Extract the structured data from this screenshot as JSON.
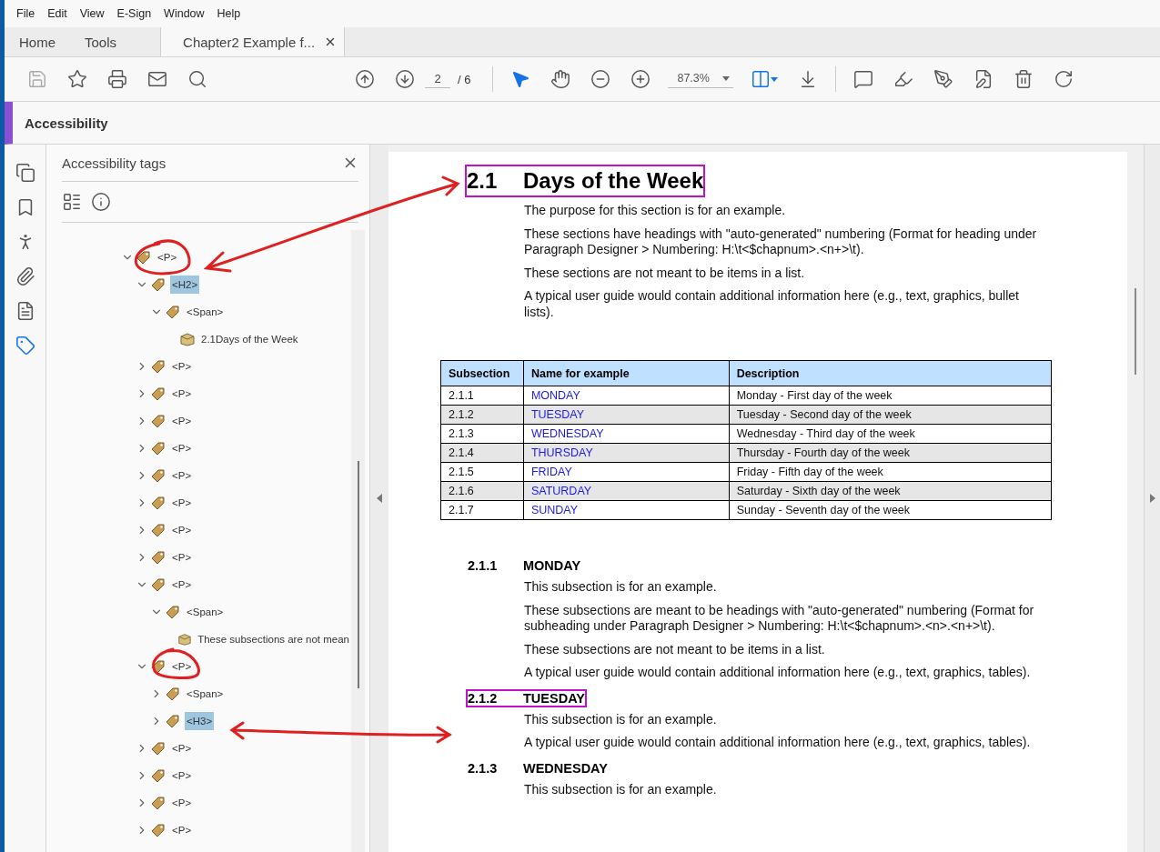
{
  "menu": [
    "File",
    "Edit",
    "View",
    "E-Sign",
    "Window",
    "Help"
  ],
  "tabs": [
    {
      "label": "Home",
      "kind": "nav",
      "selected": false
    },
    {
      "label": "Tools",
      "kind": "nav",
      "selected": false
    },
    {
      "label": "Chapter2 Example f...",
      "kind": "document",
      "selected": true
    }
  ],
  "toolbar": {
    "page": "2",
    "page_count": "/ 6",
    "zoom": "87.3%"
  },
  "tool_panel": {
    "title": "Accessibility"
  },
  "side_rail": [
    {
      "kind": "pages",
      "selected": false
    },
    {
      "kind": "bookmarks",
      "selected": false
    },
    {
      "kind": "accessibility",
      "selected": false
    },
    {
      "kind": "attachments",
      "selected": false
    },
    {
      "kind": "content",
      "selected": false
    },
    {
      "kind": "tags",
      "selected": true
    }
  ],
  "tags_panel": {
    "title": "Accessibility tags",
    "tree": [
      {
        "label": "<P>",
        "kind": "tag",
        "expanded": true,
        "selected": false,
        "children": [
          {
            "label": "<H2>",
            "kind": "tag",
            "expanded": true,
            "selected": true,
            "children": [
              {
                "label": "<Span>",
                "kind": "tag",
                "expanded": true,
                "selected": false,
                "children": [
                  {
                    "label": "2.1Days of the Week",
                    "kind": "content",
                    "selected": false
                  }
                ]
              }
            ]
          },
          {
            "label": "<P>",
            "kind": "tag",
            "expanded": false,
            "selected": false
          },
          {
            "label": "<P>",
            "kind": "tag",
            "expanded": false,
            "selected": false
          },
          {
            "label": "<P>",
            "kind": "tag",
            "expanded": false,
            "selected": false
          },
          {
            "label": "<P>",
            "kind": "tag",
            "expanded": false,
            "selected": false
          },
          {
            "label": "<P>",
            "kind": "tag",
            "expanded": false,
            "selected": false
          },
          {
            "label": "<P>",
            "kind": "tag",
            "expanded": false,
            "selected": false
          },
          {
            "label": "<P>",
            "kind": "tag",
            "expanded": false,
            "selected": false
          },
          {
            "label": "<P>",
            "kind": "tag",
            "expanded": false,
            "selected": false
          },
          {
            "label": "<P>",
            "kind": "tag",
            "expanded": true,
            "selected": false,
            "children": [
              {
                "label": "<Span>",
                "kind": "tag",
                "expanded": true,
                "selected": false,
                "children": [
                  {
                    "label": "These subsections are not mean",
                    "kind": "content",
                    "selected": false
                  }
                ]
              }
            ]
          },
          {
            "label": "<P>",
            "kind": "tag",
            "expanded": true,
            "selected": false,
            "children": [
              {
                "label": "<Span>",
                "kind": "tag",
                "expanded": false,
                "selected": false
              },
              {
                "label": "<H3>",
                "kind": "tag",
                "expanded": false,
                "selected": true
              }
            ]
          },
          {
            "label": "<P>",
            "kind": "tag",
            "expanded": false,
            "selected": false
          },
          {
            "label": "<P>",
            "kind": "tag",
            "expanded": false,
            "selected": false
          },
          {
            "label": "<P>",
            "kind": "tag",
            "expanded": false,
            "selected": false
          },
          {
            "label": "<P>",
            "kind": "tag",
            "expanded": false,
            "selected": false
          }
        ]
      }
    ]
  },
  "document": {
    "heading": {
      "number": "2.1",
      "title": "Days of the Week",
      "selected": true
    },
    "paragraphs": [
      "The purpose for this section is for an example.",
      "These sections have headings with \"auto-generated\" numbering (Format for heading under Paragraph Designer > Numbering: H:\\t<$chapnum>.<n+>\\t).",
      "These sections are not meant to be items in a list.",
      "A typical user guide would contain additional information here (e.g., text, graphics, bullet lists)."
    ],
    "table": {
      "columns": [
        "Subsection",
        "Name for example",
        "Description"
      ],
      "rows": [
        [
          "2.1.1",
          "MONDAY",
          "Monday - First day of the week"
        ],
        [
          "2.1.2",
          "TUESDAY",
          "Tuesday - Second day of the week"
        ],
        [
          "2.1.3",
          "WEDNESDAY",
          "Wednesday - Third day of the week"
        ],
        [
          "2.1.4",
          "THURSDAY",
          "Thursday - Fourth day of the week"
        ],
        [
          "2.1.5",
          "FRIDAY",
          "Friday - Fifth day of the week"
        ],
        [
          "2.1.6",
          "SATURDAY",
          "Saturday - Sixth day of the week"
        ],
        [
          "2.1.7",
          "SUNDAY",
          "Sunday - Seventh day of the week"
        ]
      ]
    },
    "subsections": [
      {
        "number": "2.1.1",
        "title": "MONDAY",
        "selected": false,
        "paragraphs": [
          "This subsection is for an example.",
          "These subsections are meant to be headings with \"auto-generated\" numbering (Format for subheading under Paragraph Designer > Numbering: H:\\t<$chapnum>.<n>.<n+>\\t).",
          "These subsections are not meant to be items in a list.",
          "A typical user guide would contain additional information here (e.g., text, graphics, tables)."
        ]
      },
      {
        "number": "2.1.2",
        "title": "TUESDAY",
        "selected": true,
        "paragraphs": [
          "This subsection is for an example.",
          "A typical user guide would contain additional information here (e.g., text, graphics, tables)."
        ]
      },
      {
        "number": "2.1.3",
        "title": "WEDNESDAY",
        "selected": false,
        "paragraphs": [
          "This subsection is for an example."
        ]
      }
    ]
  }
}
